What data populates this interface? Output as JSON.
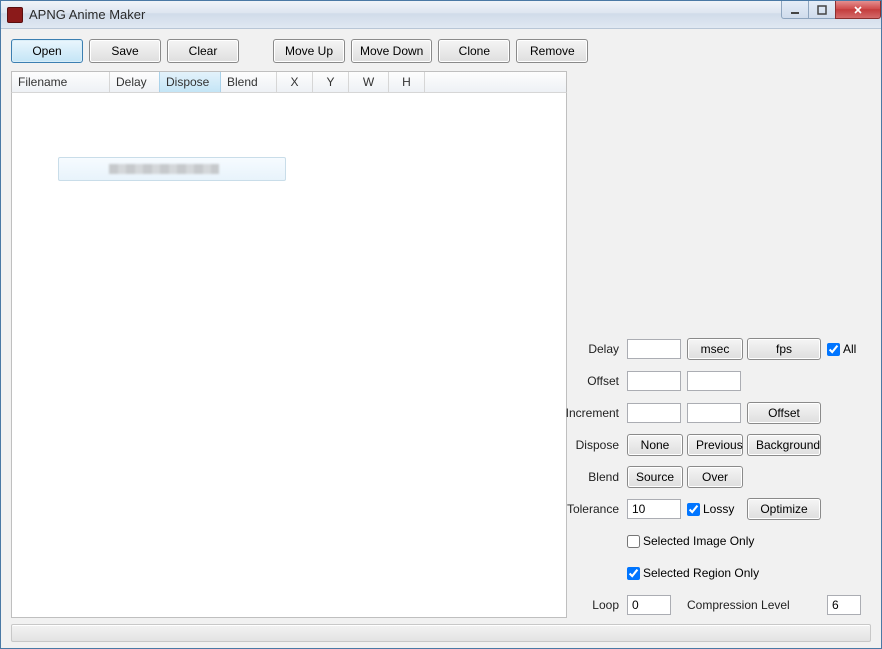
{
  "title": "APNG Anime Maker",
  "toolbar": {
    "open": "Open",
    "save": "Save",
    "clear": "Clear",
    "moveup": "Move Up",
    "movedown": "Move Down",
    "clone": "Clone",
    "remove": "Remove"
  },
  "columns": {
    "filename": "Filename",
    "delay": "Delay",
    "dispose": "Dispose",
    "blend": "Blend",
    "x": "X",
    "y": "Y",
    "w": "W",
    "h": "H"
  },
  "side": {
    "delay_label": "Delay",
    "msec_btn": "msec",
    "fps_btn": "fps",
    "all_label": "All",
    "all_checked": true,
    "offset_label": "Offset",
    "increment_label": "Increment",
    "offset_btn": "Offset",
    "dispose_label": "Dispose",
    "none_btn": "None",
    "previous_btn": "Previous",
    "background_btn": "Background",
    "blend_label": "Blend",
    "source_btn": "Source",
    "over_btn": "Over",
    "tolerance_label": "Tolerance",
    "tolerance_value": "10",
    "lossy_label": "Lossy",
    "lossy_checked": true,
    "optimize_btn": "Optimize",
    "selimg_label": "Selected Image Only",
    "selimg_checked": false,
    "selreg_label": "Selected Region Only",
    "selreg_checked": true,
    "loop_label": "Loop",
    "loop_value": "0",
    "comp_label": "Compression Level",
    "comp_value": "6"
  }
}
